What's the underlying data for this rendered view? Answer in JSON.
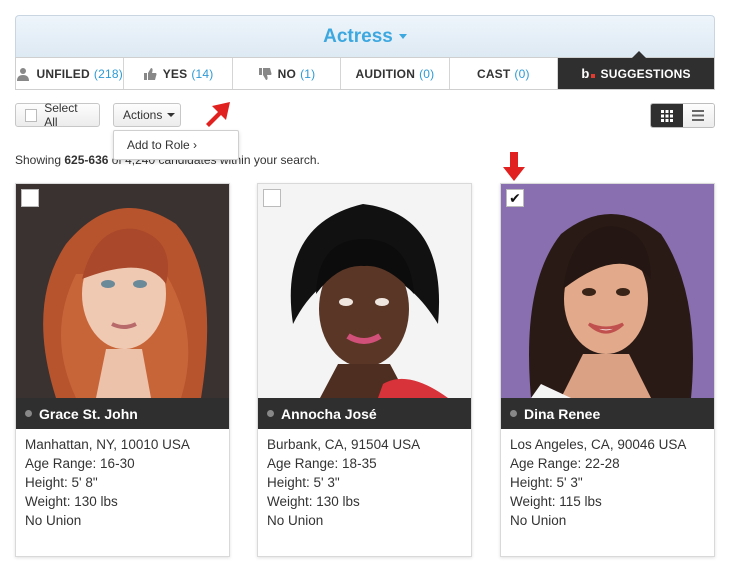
{
  "role": {
    "title": "Actress"
  },
  "tabs": [
    {
      "label": "UNFILED",
      "count": "(218)",
      "icon": "person-icon"
    },
    {
      "label": "YES",
      "count": "(14)",
      "icon": "thumbs-up-icon"
    },
    {
      "label": "NO",
      "count": "(1)",
      "icon": "thumbs-down-icon"
    },
    {
      "label": "AUDITION",
      "count": "(0)"
    },
    {
      "label": "CAST",
      "count": "(0)"
    },
    {
      "label": "SUGGESTIONS",
      "logo": "b"
    }
  ],
  "toolbar": {
    "select_all": "Select All",
    "actions": "Actions",
    "dropdown_item": "Add to Role ›"
  },
  "showing": {
    "prefix": "Showing ",
    "range": "625-636",
    "suffix": " of 4,240 candidates within your search."
  },
  "colors": {
    "accent": "#3da8e0",
    "count": "#2d9bd6",
    "dark": "#2f2f2f",
    "arrow": "#e0211f"
  },
  "cards": [
    {
      "name": "Grace St. John",
      "checked": false,
      "location": "Manhattan, NY, 10010 USA",
      "age": "Age Range: 16-30",
      "height": "Height: 5' 8\"",
      "weight": "Weight: 130 lbs",
      "union": "No Union"
    },
    {
      "name": "Annocha José",
      "checked": false,
      "location": "Burbank, CA, 91504 USA",
      "age": "Age Range: 18-35",
      "height": "Height: 5' 3\"",
      "weight": "Weight: 130 lbs",
      "union": "No Union"
    },
    {
      "name": "Dina Renee",
      "checked": true,
      "check_mark": "✔",
      "location": "Los Angeles, CA, 90046 USA",
      "age": "Age Range: 22-28",
      "height": "Height: 5' 3\"",
      "weight": "Weight: 115 lbs",
      "union": "No Union"
    }
  ]
}
